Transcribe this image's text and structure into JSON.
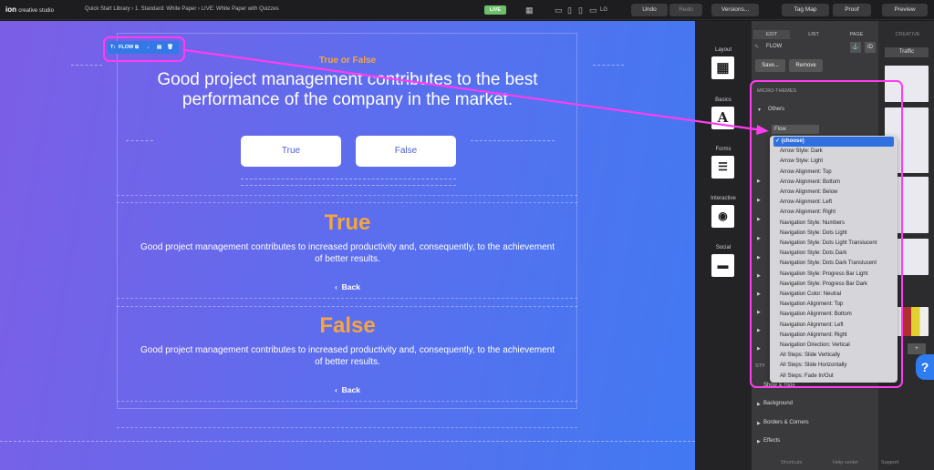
{
  "app": {
    "logo": "ion",
    "logo_sub": "creative studio",
    "breadcrumb": "Quick Start Library  ›  1. Standard: White Paper  ›  LIVE: White Paper with Quizzes",
    "live_badge": "LIVE"
  },
  "toolbar": {
    "undo": "Undo",
    "redo": "Redo",
    "versions": "Versions...",
    "tag_map": "Tag Map",
    "proof": "Proof",
    "preview": "Preview"
  },
  "canvas": {
    "section_title": "True or False",
    "question": "Good project management contributes to the best performance of the company in the market.",
    "answers": [
      "True",
      "False"
    ],
    "result_true": {
      "title": "True",
      "text": "Good project management contributes to increased productivity and, consequently, to the achievement of better results.",
      "back": "Back"
    },
    "result_false": {
      "title": "False",
      "text": "Good project management contributes to increased productivity and, consequently, to the achievement of better results.",
      "back": "Back"
    },
    "flow_label": "FLOW"
  },
  "left_icons": [
    {
      "label": "Layout",
      "icon": "layout-icon"
    },
    {
      "label": "Basics",
      "icon": "letter-a-icon",
      "glyph": "A"
    },
    {
      "label": "Forms",
      "icon": "form-icon"
    },
    {
      "label": "Interactive",
      "icon": "play-icon"
    },
    {
      "label": "Social",
      "icon": "chat-icon"
    }
  ],
  "panel": {
    "tabs": [
      "EDIT",
      "LIST",
      "PAGE"
    ],
    "creative_tab": "CREATIVE",
    "traffic": "Traffic",
    "element_name": "FLOW",
    "id_label": "ID",
    "save": "Save...",
    "remove": "Remove",
    "micro_themes": "MICRO-THEMES",
    "others": "Others",
    "select_value": "Flow",
    "styles_label": "STY",
    "show_hide": "Show & Hide",
    "sections": [
      "Background",
      "Borders & Corners",
      "Effects"
    ]
  },
  "dropdown": {
    "options": [
      "(choose)",
      "Arrow Style: Dark",
      "Arrow Style: Light",
      "Arrow Alignment: Top",
      "Arrow Alignment: Bottom",
      "Arrow Alignment: Below",
      "Arrow Alignment: Left",
      "Arrow Alignment: Right",
      "Navigation Style: Numbers",
      "Navigation Style: Dots Light",
      "Navigation Style: Dots Light Translucent",
      "Navigation Style: Dots Dark",
      "Navigation Style: Dots Dark Translucent",
      "Navigation Style: Progress Bar Light",
      "Navigation Style: Progress Bar Dark",
      "Navigation Color: Neutral",
      "Navigation Alignment: Top",
      "Navigation Alignment: Bottom",
      "Navigation Alignment: Left",
      "Navigation Alignment: Right",
      "Navigation Direction: Vertical",
      "All Steps: Slide Vertically",
      "All Steps: Slide Horizontally",
      "All Steps: Fade In/Out"
    ],
    "selected": "(choose)"
  },
  "footer": {
    "shortcuts": "Shortcuts",
    "help_center": "Help center",
    "support": "Support"
  },
  "help": "?",
  "colors": {
    "highlight": "#ff3df0",
    "accent": "#f5a540",
    "blue": "#2f7bf0"
  }
}
